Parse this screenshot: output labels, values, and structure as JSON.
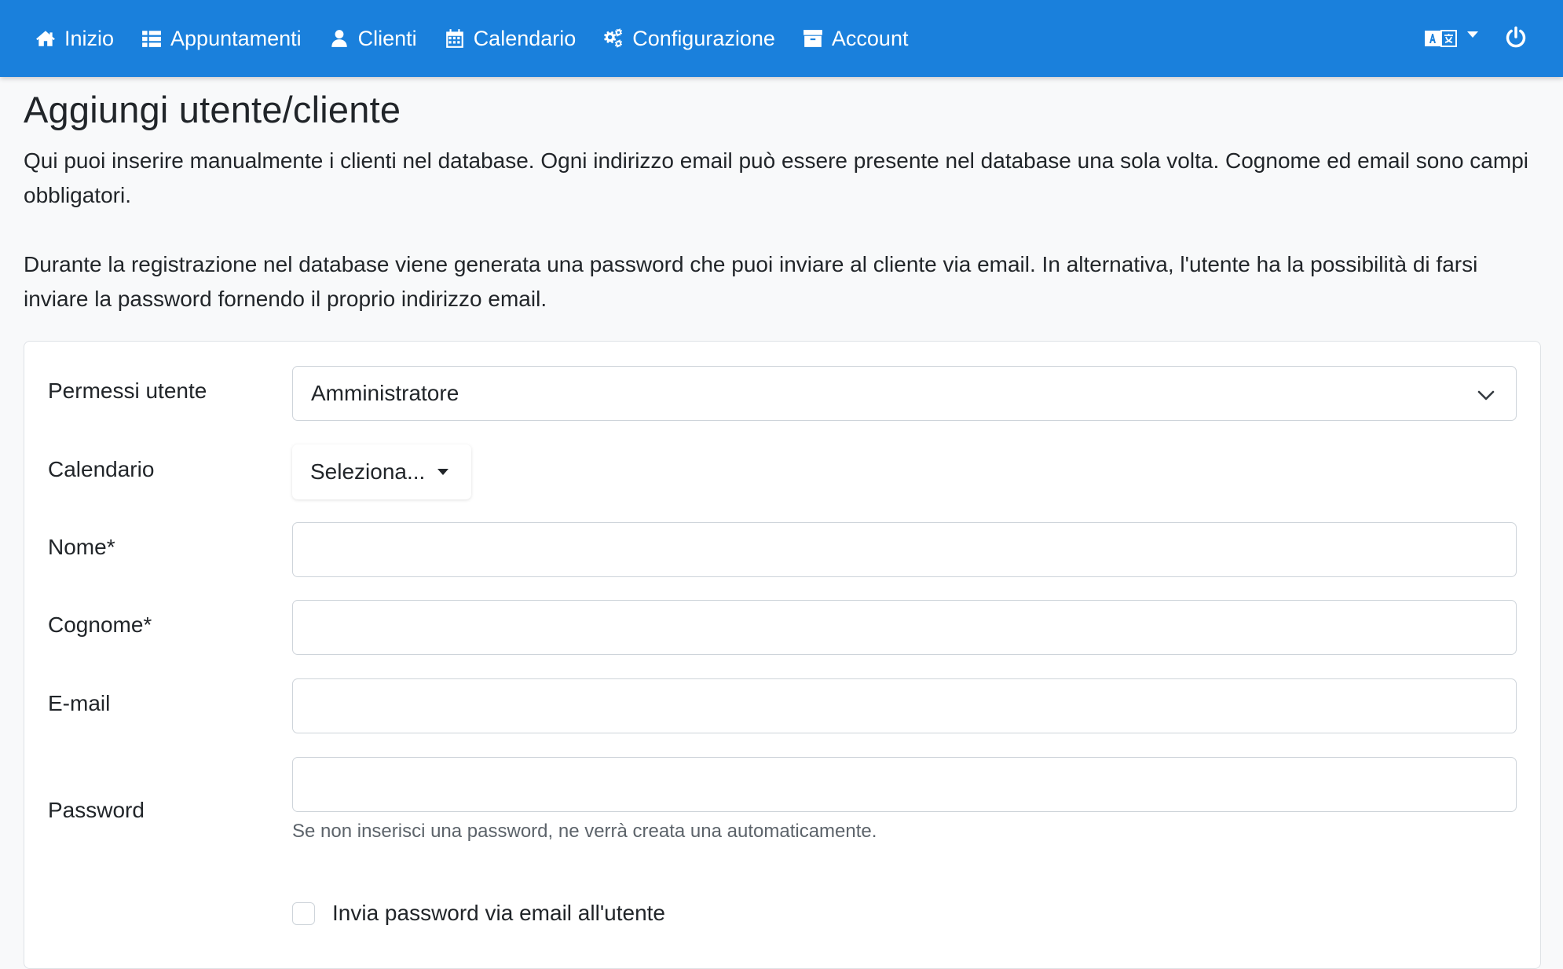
{
  "nav": {
    "items": [
      {
        "label": "Inizio",
        "icon": "home-icon"
      },
      {
        "label": "Appuntamenti",
        "icon": "list-icon"
      },
      {
        "label": "Clienti",
        "icon": "user-icon"
      },
      {
        "label": "Calendario",
        "icon": "calendar-icon"
      },
      {
        "label": "Configurazione",
        "icon": "gears-icon"
      },
      {
        "label": "Account",
        "icon": "archive-icon"
      }
    ],
    "language_icon": "language-icon",
    "power_icon": "power-icon",
    "color": "#1a80dc"
  },
  "page": {
    "title": "Aggiungi utente/cliente",
    "intro_1": "Qui puoi inserire manualmente i clienti nel database. Ogni indirizzo email può essere presente nel database una sola volta. Cognome ed email sono campi obbligatori.",
    "intro_2": "Durante la registrazione nel database viene generata una password che puoi inviare al cliente via email. In alternativa, l'utente ha la possibilità di farsi inviare la password fornendo il proprio indirizzo email."
  },
  "form": {
    "permissions": {
      "label": "Permessi utente",
      "value": "Amministratore"
    },
    "calendar": {
      "label": "Calendario",
      "value": "Seleziona..."
    },
    "first_name": {
      "label": "Nome*",
      "value": ""
    },
    "last_name": {
      "label": "Cognome*",
      "value": ""
    },
    "email": {
      "label": "E-mail",
      "value": ""
    },
    "password": {
      "label": "Password",
      "value": "",
      "help": "Se non inserisci una password, ne verrà creata una automaticamente."
    },
    "send_password": {
      "label": "Invia password via email all'utente",
      "checked": false
    }
  }
}
